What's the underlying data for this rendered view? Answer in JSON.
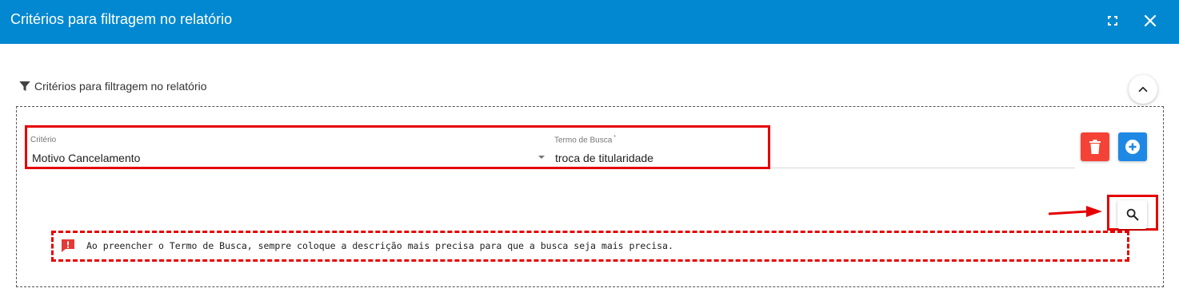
{
  "dialog": {
    "title": "Critérios para filtragem no relatório",
    "header_bg": "#0288d1"
  },
  "section": {
    "title": "Critérios para filtragem no relatório"
  },
  "criterion": {
    "label": "Critério",
    "value": "Motivo Cancelamento"
  },
  "search_term": {
    "label": "Termo de Busca",
    "required_mark": "*",
    "value": "troca de titularidade"
  },
  "warning": {
    "text": "Ao preencher o Termo de Busca, sempre coloque a descrição mais precisa para que a busca seja mais precisa."
  },
  "colors": {
    "delete": "#f44336",
    "add": "#1e88e5",
    "annotation": "#e50000"
  },
  "icons": {
    "expand": "fullscreen-icon",
    "close": "close-icon",
    "filter": "filter-icon",
    "collapse": "chevron-up-icon",
    "delete": "trash-icon",
    "add": "add-circle-icon",
    "search": "search-icon",
    "warning": "alert-message-icon"
  }
}
